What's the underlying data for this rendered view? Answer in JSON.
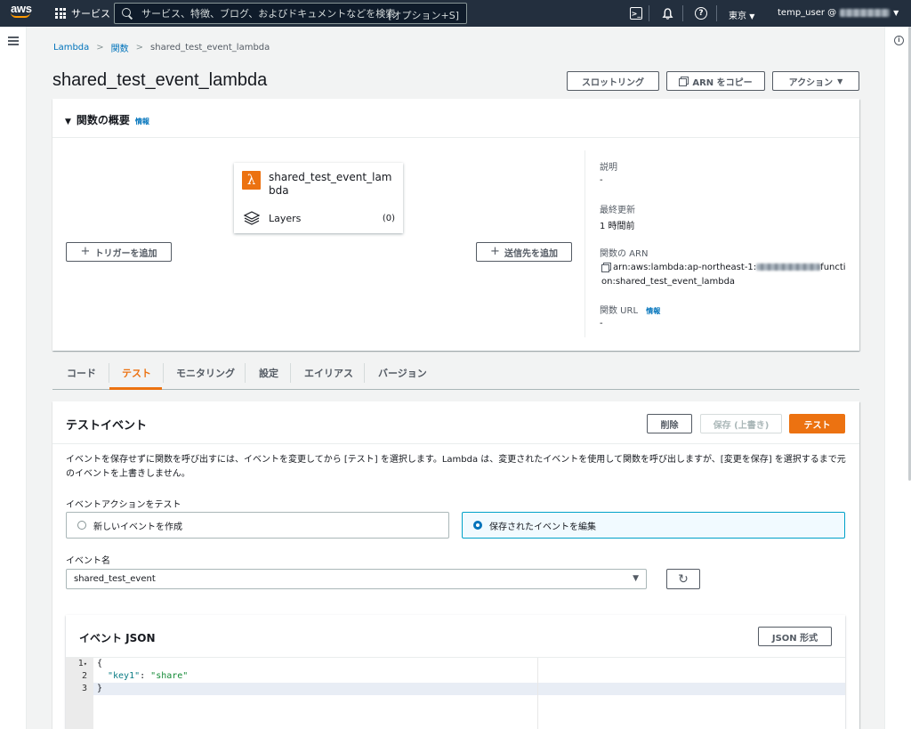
{
  "topnav": {
    "logo_text": "aws",
    "services_label": "サービス",
    "search_placeholder": "サービス、特徴、ブログ、およびドキュメントなどを検索",
    "search_shortcut": "[オプション+S]",
    "region_label": "東京",
    "user_label": "temp_user @"
  },
  "breadcrumb": {
    "items": [
      "Lambda",
      "関数",
      "shared_test_event_lambda"
    ]
  },
  "header": {
    "title": "shared_test_event_lambda",
    "throttle_button": "スロットリング",
    "copy_arn_button": "ARN をコピー",
    "actions_button": "アクション"
  },
  "overview": {
    "title": "関数の概要",
    "info_link": "情報",
    "function_name": "shared_test_event_lambda",
    "layers_label": "Layers",
    "layers_count": "(0)",
    "add_trigger_button": "トリガーを追加",
    "add_destination_button": "送信先を追加",
    "description_label": "説明",
    "description_value": "-",
    "last_modified_label": "最終更新",
    "last_modified_value": "1 時間前",
    "arn_label": "関数の ARN",
    "arn_prefix": "arn:aws:lambda:ap-northeast-1:",
    "arn_suffix": "function:shared_test_event_lambda",
    "url_label": "関数 URL",
    "url_info_link": "情報",
    "url_value": "-"
  },
  "tabs": [
    {
      "label": "コード",
      "active": false
    },
    {
      "label": "テスト",
      "active": true
    },
    {
      "label": "モニタリング",
      "active": false
    },
    {
      "label": "設定",
      "active": false
    },
    {
      "label": "エイリアス",
      "active": false
    },
    {
      "label": "バージョン",
      "active": false
    }
  ],
  "test_event": {
    "title": "テストイベント",
    "delete_button": "削除",
    "save_button": "保存 (上書き)",
    "test_button": "テスト",
    "description": "イベントを保存せずに関数を呼び出すには、イベントを変更してから [テスト] を選択します。Lambda は、変更されたイベントを使用して関数を呼び出しますが、[変更を保存] を選択するまで元のイベントを上書きしません。",
    "action_label": "イベントアクションをテスト",
    "option_new": "新しいイベントを作成",
    "option_edit": "保存されたイベントを編集",
    "selected_option": "option_edit",
    "event_name_label": "イベント名",
    "event_name_value": "shared_test_event",
    "json_title": "イベント JSON",
    "json_format_button": "JSON 形式",
    "code_lines": [
      "1",
      "2",
      "3"
    ],
    "code_line1": "{",
    "code_key": "\"key1\"",
    "code_colon": ": ",
    "code_val": "\"share\"",
    "code_line3": "}"
  },
  "colors": {
    "nav_bg": "#232f3e",
    "accent_orange": "#ec7211",
    "link_blue": "#0073bb"
  }
}
